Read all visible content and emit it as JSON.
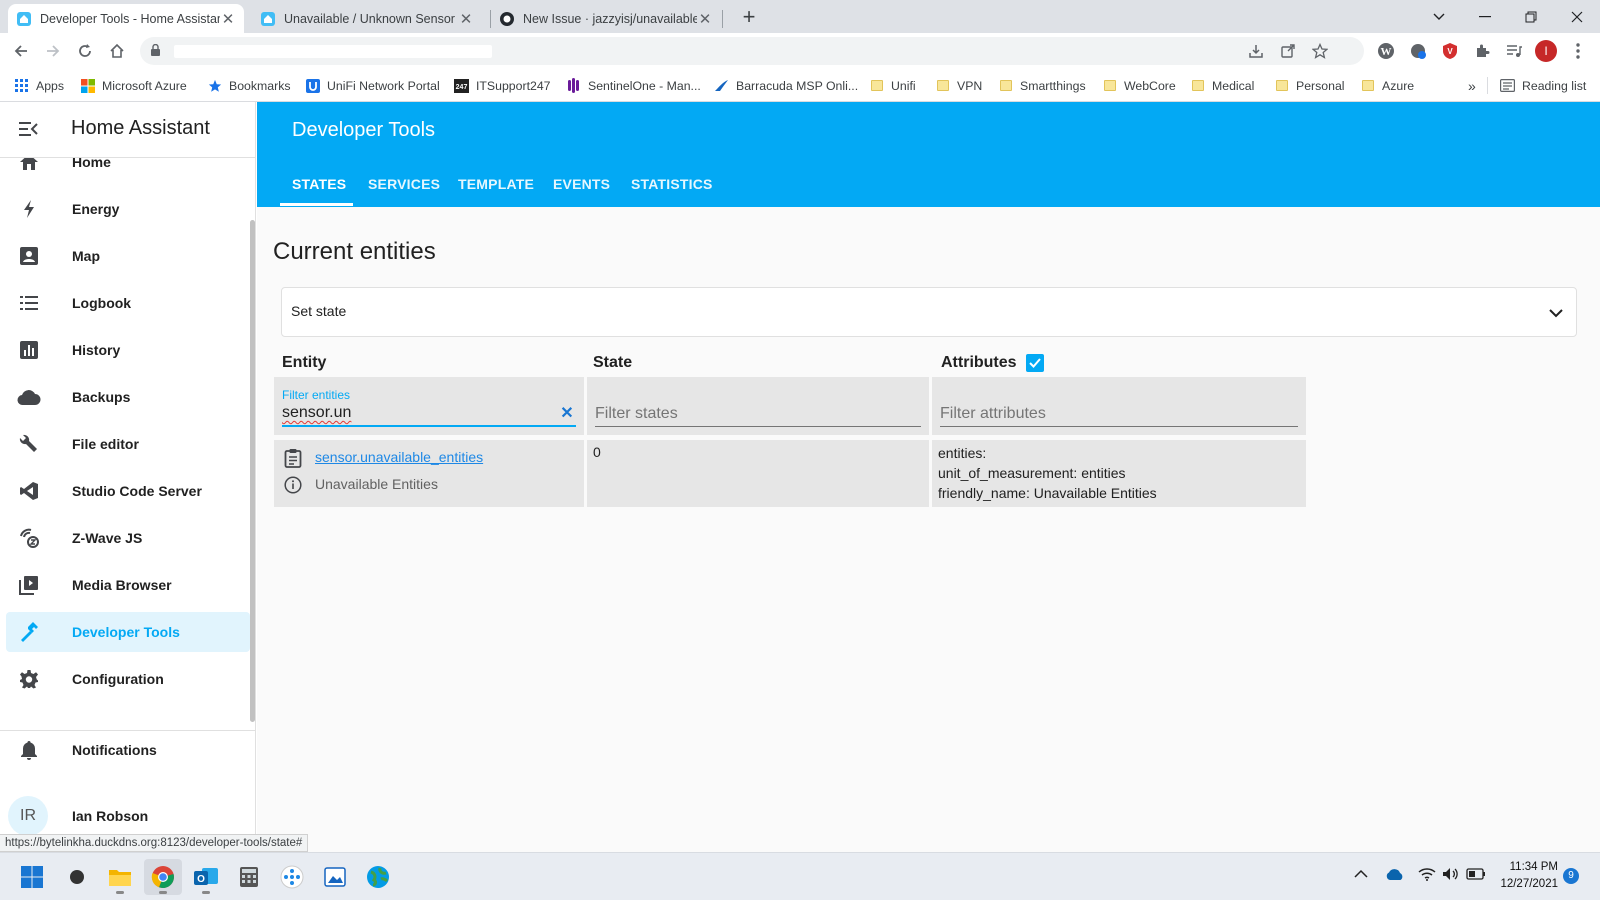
{
  "browser": {
    "tabs": [
      {
        "title": "Developer Tools - Home Assistant",
        "active": true
      },
      {
        "title": "Unavailable / Unknown Sensor Monitor",
        "active": false
      },
      {
        "title": "New Issue · jazzyisj/unavailable-entities",
        "active": false
      }
    ],
    "new_tab_label": "+",
    "bookmarks": [
      {
        "label": "Apps",
        "icon": "apps-grid-icon"
      },
      {
        "label": "Microsoft Azure",
        "icon": "microsoft-logo-icon"
      },
      {
        "label": "Bookmarks",
        "icon": "star-icon"
      },
      {
        "label": "UniFi Network Portal",
        "icon": "unifi-icon"
      },
      {
        "label": "ITSupport247",
        "icon": "itsupport-icon"
      },
      {
        "label": "SentinelOne - Man...",
        "icon": "sentinelone-icon"
      },
      {
        "label": "Barracuda MSP Onli...",
        "icon": "barracuda-icon"
      },
      {
        "label": "Unifi",
        "icon": "folder-icon"
      },
      {
        "label": "VPN",
        "icon": "folder-icon"
      },
      {
        "label": "Smartthings",
        "icon": "folder-icon"
      },
      {
        "label": "WebCore",
        "icon": "folder-icon"
      },
      {
        "label": "Medical",
        "icon": "folder-icon"
      },
      {
        "label": "Personal",
        "icon": "folder-icon"
      },
      {
        "label": "Azure",
        "icon": "folder-icon"
      }
    ],
    "more_bookmarks": "»",
    "reading_list": "Reading list",
    "profile_initial": "I",
    "status_url": "https://bytelinkha.duckdns.org:8123/developer-tools/state#"
  },
  "sidebar": {
    "title": "Home Assistant",
    "items": [
      {
        "label": "Home",
        "icon": "home-icon"
      },
      {
        "label": "Energy",
        "icon": "lightning-icon"
      },
      {
        "label": "Map",
        "icon": "account-box-icon"
      },
      {
        "label": "Logbook",
        "icon": "list-icon"
      },
      {
        "label": "History",
        "icon": "chart-box-icon"
      },
      {
        "label": "Backups",
        "icon": "cloud-icon"
      },
      {
        "label": "File editor",
        "icon": "wrench-icon"
      },
      {
        "label": "Studio Code Server",
        "icon": "vscode-icon"
      },
      {
        "label": "Z-Wave JS",
        "icon": "zwave-icon"
      },
      {
        "label": "Media Browser",
        "icon": "play-box-icon"
      },
      {
        "label": "Developer Tools",
        "icon": "hammer-icon",
        "selected": true
      },
      {
        "label": "Configuration",
        "icon": "gear-icon"
      }
    ],
    "notifications": "Notifications",
    "user_name": "Ian Robson",
    "user_initials": "IR"
  },
  "header": {
    "title": "Developer Tools",
    "tabs": [
      "STATES",
      "SERVICES",
      "TEMPLATE",
      "EVENTS",
      "STATISTICS"
    ],
    "selected_tab": "STATES"
  },
  "main": {
    "page_title": "Current entities",
    "set_state_label": "Set state",
    "columns": {
      "entity": "Entity",
      "state": "State",
      "attributes": "Attributes"
    },
    "attributes_checked": true,
    "filters": {
      "entity_label": "Filter entities",
      "entity_value": "sensor.un",
      "state_placeholder": "Filter states",
      "attributes_placeholder": "Filter attributes"
    },
    "rows": [
      {
        "entity_id": "sensor.unavailable_entities",
        "friendly_name": "Unavailable Entities",
        "state": "0",
        "attributes": [
          "entities:",
          "unit_of_measurement: entities",
          "friendly_name: Unavailable Entities"
        ]
      }
    ]
  },
  "taskbar": {
    "time": "11:34 PM",
    "date": "12/27/2021",
    "notification_count": "9"
  },
  "colors": {
    "accent": "#03a9f4",
    "sidebar_selected_bg": "#e1f4fd",
    "cell_bg": "#e6e6e6"
  }
}
